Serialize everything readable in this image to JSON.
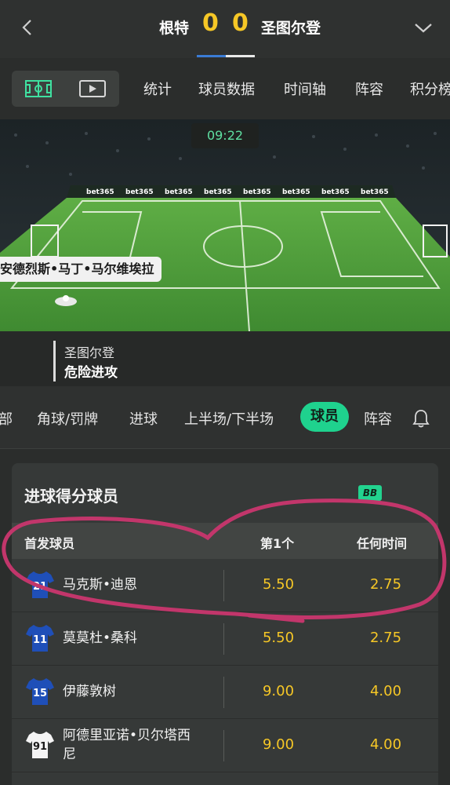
{
  "match": {
    "home_team": "根特",
    "home_score": "0",
    "away_score": "0",
    "away_team": "圣图尔登"
  },
  "nav": {
    "items": [
      "统计",
      "球员数据",
      "时间轴",
      "阵容",
      "积分榜"
    ]
  },
  "pitch": {
    "clock": "09:22",
    "player_label": "安德烈斯•马丁•马尔维埃拉",
    "ad_board": "bet365"
  },
  "event": {
    "team": "圣图尔登",
    "description": "危险进攻"
  },
  "market_tabs": {
    "items": [
      "部",
      "角球/罚牌",
      "进球",
      "上半场/下半场"
    ],
    "active": "球员",
    "trailing": "阵容"
  },
  "market": {
    "title": "进球得分球员",
    "badge": "BB",
    "columns": {
      "player": "首发球员",
      "first": "第1个",
      "anytime": "任何时间"
    },
    "rows": [
      {
        "number": "21",
        "kit": "blue",
        "name": "马克斯•迪恩",
        "first": "5.50",
        "anytime": "2.75"
      },
      {
        "number": "11",
        "kit": "blue",
        "name": "莫莫杜•桑科",
        "first": "5.50",
        "anytime": "2.75"
      },
      {
        "number": "15",
        "kit": "blue",
        "name": "伊藤敦树",
        "first": "9.00",
        "anytime": "4.00"
      },
      {
        "number": "91",
        "kit": "white",
        "name": "阿德里亚诺•贝尔塔西尼",
        "name_line1": "阿德里亚诺•贝尔塔西",
        "name_line2": "尼",
        "first": "9.00",
        "anytime": "4.00"
      }
    ]
  },
  "colors": {
    "accent_green": "#1fd28e",
    "odds_yellow": "#f6c726",
    "score_yellow": "#f6c726",
    "annotation": "#c2366b"
  }
}
